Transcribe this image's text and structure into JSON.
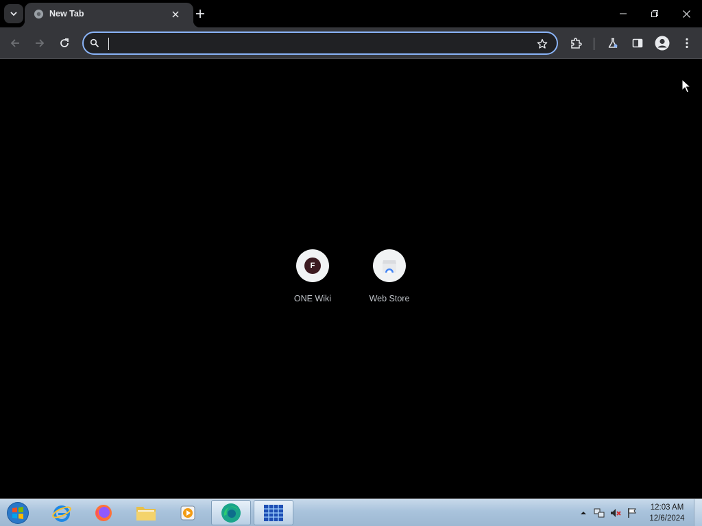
{
  "tab": {
    "title": "New Tab"
  },
  "omnibox": {
    "value": "",
    "placeholder": ""
  },
  "shortcuts": [
    {
      "label": "ONE Wiki",
      "badge": "F"
    },
    {
      "label": "Web Store"
    }
  ],
  "taskbar": {
    "apps": [
      "start-orb",
      "internet-explorer",
      "firefox",
      "file-explorer",
      "media-player",
      "edge-chromium",
      "task-manager-app"
    ],
    "clock": {
      "time": "12:03 AM",
      "date": "12/6/2024"
    }
  },
  "colors": {
    "accent": "#8ab4f8",
    "toolbar": "#35363a",
    "background": "#000000"
  }
}
